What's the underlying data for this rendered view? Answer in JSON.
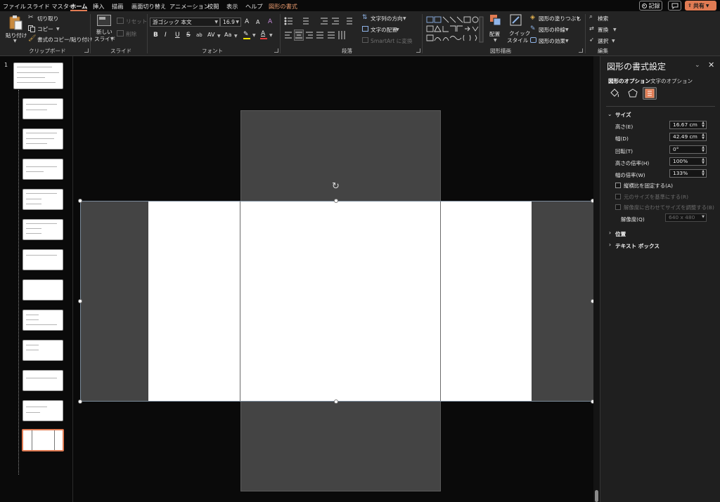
{
  "menu": {
    "tabs": [
      "ファイル",
      "スライド マスター",
      "ホーム",
      "挿入",
      "描画",
      "画面切り替え",
      "アニメーション",
      "校閲",
      "表示",
      "ヘルプ",
      "図形の書式"
    ],
    "active_tab": "ホーム",
    "record_label": "記録",
    "share_label": "共有"
  },
  "ribbon": {
    "clipboard": {
      "paste_label": "貼り付け",
      "cut_label": "切り取り",
      "copy_label": "コピー",
      "format_painter_label": "書式のコピー/貼り付け",
      "group_label": "クリップボード"
    },
    "slides": {
      "new_slide_label": "新しい スライド",
      "new_slide_line1": "新しい",
      "new_slide_line2": "スライド",
      "reset_label": "リセット",
      "delete_label": "削除",
      "group_label": "スライド"
    },
    "font": {
      "font_name": "游ゴシック 本文",
      "font_size": "16.9",
      "group_label": "フォント",
      "bold": "B",
      "italic": "I",
      "underline": "U",
      "strike": "S",
      "shadow": "ab",
      "spacing": "AV",
      "case": "Aa",
      "grow": "A",
      "shrink": "A",
      "clear": "A"
    },
    "paragraph": {
      "text_direction_label": "文字列の方向",
      "align_text_label": "文字の配置",
      "smartart_label": "SmartArt に変換",
      "group_label": "段落"
    },
    "drawing": {
      "arrange_label": "配置",
      "quick_styles_label": "クイック スタイル",
      "quick_styles_line1": "クイック",
      "quick_styles_line2": "スタイル",
      "fill_label": "図形の塗りつぶし",
      "outline_label": "図形の枠線",
      "effects_label": "図形の効果",
      "group_label": "図形描画"
    },
    "editing": {
      "find_label": "検索",
      "replace_label": "置換",
      "select_label": "選択",
      "group_label": "編集"
    }
  },
  "thumbnails": {
    "slide_number": "1",
    "count": 13,
    "selected_index": 12
  },
  "format_pane": {
    "title": "図形の書式設定",
    "tabs": [
      "図形のオプション",
      "文字のオプション"
    ],
    "active_tab": "図形のオプション",
    "size_section": "サイズ",
    "fields": [
      {
        "label": "高さ(E)",
        "value": "16.67 cm"
      },
      {
        "label": "幅(D)",
        "value": "42.49 cm"
      },
      {
        "label": "回転(T)",
        "value": "0°"
      },
      {
        "label": "高さの倍率(H)",
        "value": "100%"
      },
      {
        "label": "幅の倍率(W)",
        "value": "133%"
      }
    ],
    "checkboxes": [
      {
        "label": "縦横比を固定する(A)",
        "checked": false,
        "enabled": true
      },
      {
        "label": "元のサイズを基準にする(R)",
        "checked": false,
        "enabled": false
      },
      {
        "label": "解像度に合わせてサイズを調整する(B)",
        "checked": false,
        "enabled": false
      }
    ],
    "resolution_label": "解像度(Q)",
    "resolution_value": "640 x 480",
    "position_section": "位置",
    "textbox_section": "テキスト ボックス"
  },
  "colors": {
    "accent": "#e07b53",
    "ribbon_bg": "#242424",
    "app_bg": "#0a0a0a",
    "pane_bg": "#1f1f1f",
    "shape_gray": "#444444",
    "slide_white": "#ffffff"
  }
}
